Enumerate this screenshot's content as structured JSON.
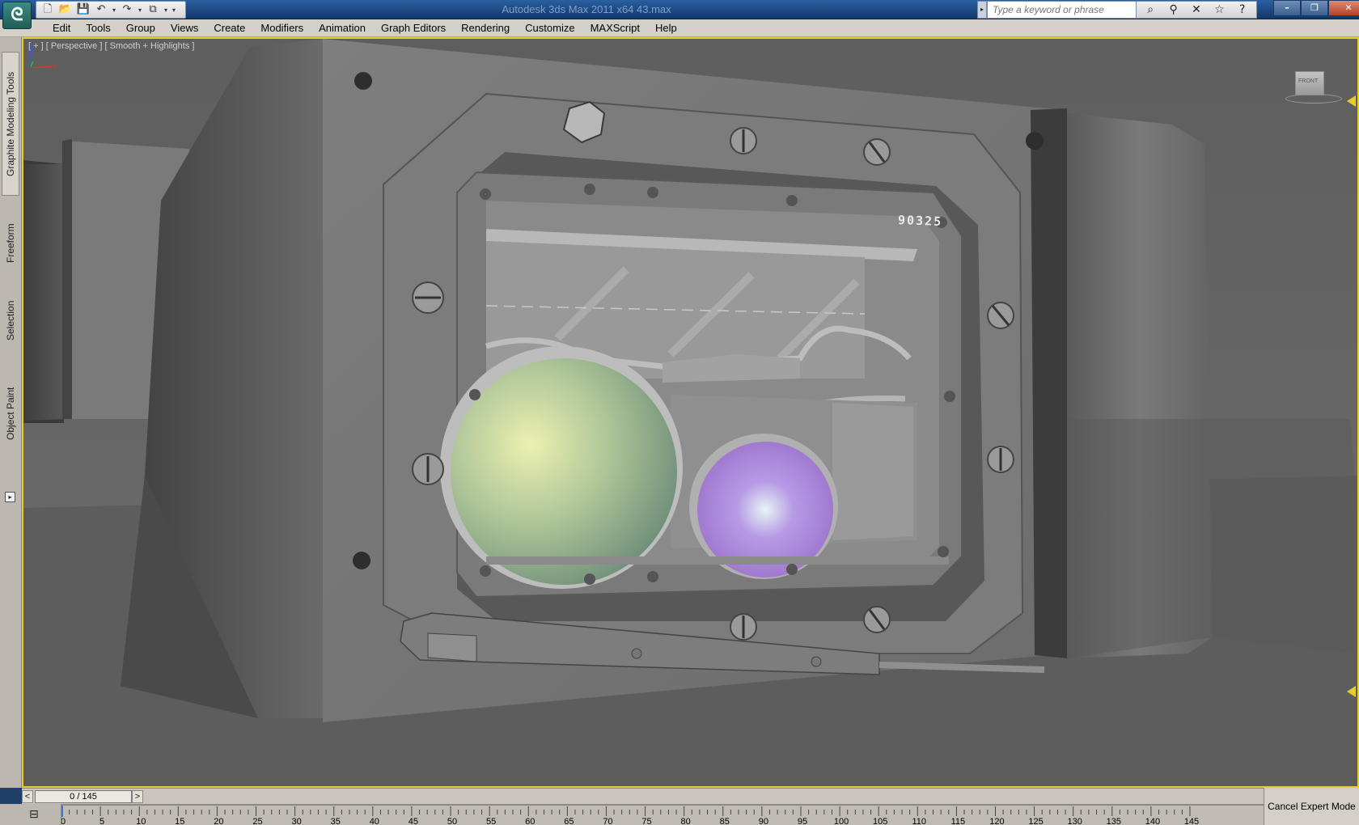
{
  "titlebar": {
    "app_icon": "3ds-max-logo-icon",
    "title": "Autodesk 3ds Max  2011 x64      43.max",
    "search_placeholder": "Type a keyword or phrase",
    "quick_access_icons": [
      "new-file-icon",
      "open-file-icon",
      "save-icon",
      "undo-icon",
      "redo-icon",
      "project-folder-icon",
      "customize-arrow-icon"
    ],
    "tool_icons": [
      "binoculars-icon",
      "communication-center-icon",
      "subscription-icon",
      "favorites-star-icon",
      "help-icon"
    ],
    "window_controls": [
      "minimize-icon",
      "restore-icon",
      "close-icon"
    ]
  },
  "menubar": {
    "items": [
      "Edit",
      "Tools",
      "Group",
      "Views",
      "Create",
      "Modifiers",
      "Animation",
      "Graph Editors",
      "Rendering",
      "Customize",
      "MAXScript",
      "Help"
    ]
  },
  "side_tabs": {
    "graphite": "Graphite Modeling Tools",
    "freeform": "Freeform",
    "selection": "Selection",
    "object_paint": "Object Paint"
  },
  "viewport": {
    "label": "[ + ] [ Perspective ] [ Smooth + Highlights ]",
    "viewcube_label": "FRONT",
    "serial_text": "90325",
    "accent_color": "#e8cc2a",
    "gizmo_axes": [
      "x",
      "y",
      "z"
    ]
  },
  "timeslider": {
    "position": "0 / 145",
    "current_frame": 0,
    "total_frames": 145,
    "prev_label": "<",
    "next_label": ">"
  },
  "trackbar": {
    "tick_labels": [
      "0",
      "5",
      "10",
      "15",
      "20",
      "25",
      "30",
      "35",
      "40",
      "45",
      "50",
      "55",
      "60",
      "65",
      "70",
      "75",
      "80",
      "85",
      "90",
      "95",
      "100",
      "105",
      "110",
      "115",
      "120",
      "125",
      "130",
      "135",
      "140",
      "145"
    ]
  },
  "status": {
    "cancel_expert_mode": "Cancel Expert Mode"
  }
}
